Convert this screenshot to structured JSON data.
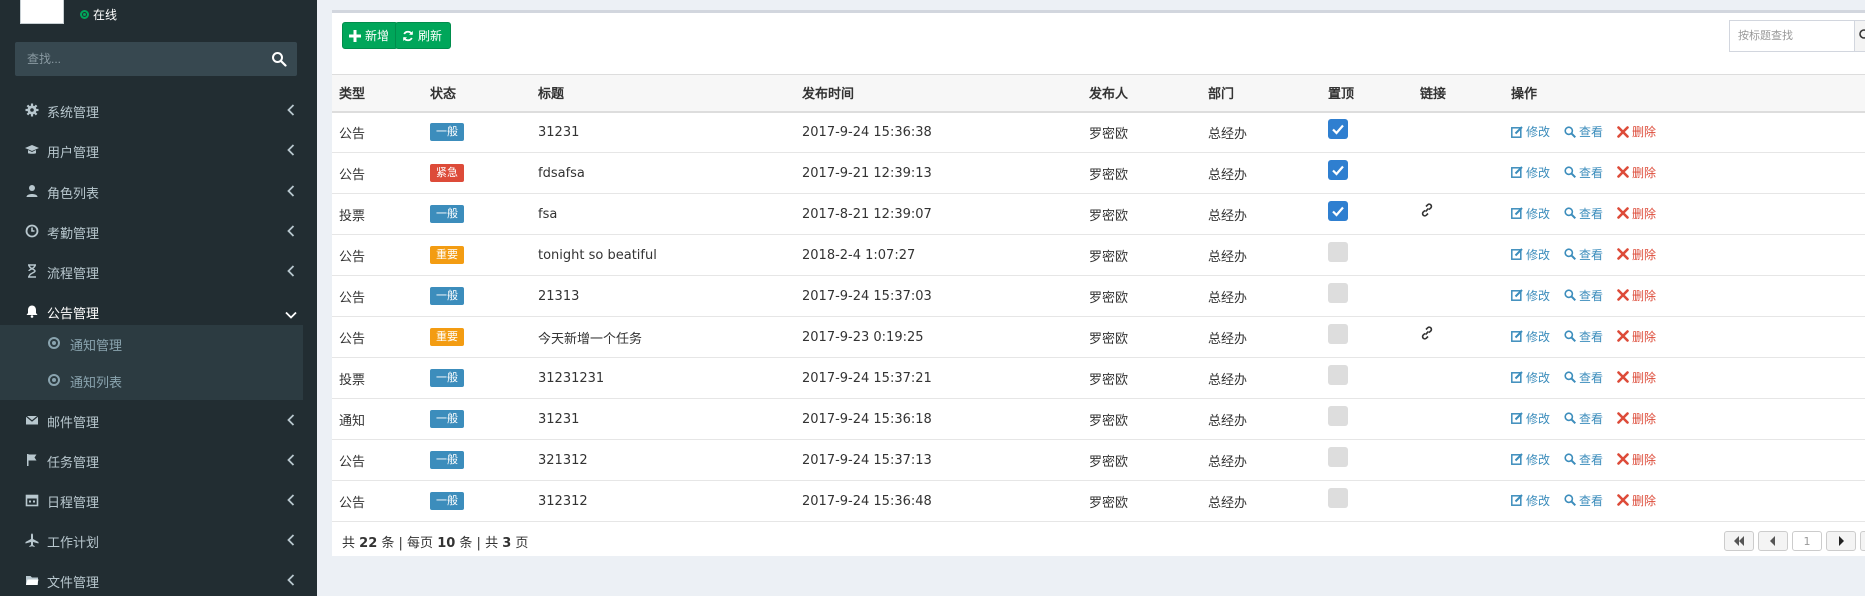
{
  "sidebar": {
    "status": "在线",
    "search_placeholder": "查找...",
    "items": [
      {
        "label": "系统管理",
        "icon": "gear-icon"
      },
      {
        "label": "用户管理",
        "icon": "graduation-cap-icon"
      },
      {
        "label": "角色列表",
        "icon": "user-icon"
      },
      {
        "label": "考勤管理",
        "icon": "clock-icon"
      },
      {
        "label": "流程管理",
        "icon": "hourglass-icon"
      },
      {
        "label": "公告管理",
        "icon": "bell-icon"
      },
      {
        "label": "邮件管理",
        "icon": "envelope-icon"
      },
      {
        "label": "任务管理",
        "icon": "flag-icon"
      },
      {
        "label": "日程管理",
        "icon": "calendar-icon"
      },
      {
        "label": "工作计划",
        "icon": "plane-icon"
      },
      {
        "label": "文件管理",
        "icon": "folder-icon"
      }
    ],
    "submenu": [
      {
        "label": "通知管理"
      },
      {
        "label": "通知列表"
      }
    ]
  },
  "toolbar": {
    "add_label": "新增",
    "refresh_label": "刷新",
    "search_placeholder": "按标题查找"
  },
  "table": {
    "headers": [
      "类型",
      "状态",
      "标题",
      "发布时间",
      "发布人",
      "部门",
      "置顶",
      "链接",
      "操作"
    ],
    "actions": {
      "edit": "修改",
      "view": "查看",
      "delete": "删除"
    },
    "rows": [
      {
        "type": "公告",
        "status": "一般",
        "title": "31231",
        "time": "2017-9-24 15:36:38",
        "publisher": "罗密欧",
        "dept": "总经办",
        "pinned": true,
        "link": false
      },
      {
        "type": "公告",
        "status": "紧急",
        "title": "fdsafsa",
        "time": "2017-9-21 12:39:13",
        "publisher": "罗密欧",
        "dept": "总经办",
        "pinned": true,
        "link": false
      },
      {
        "type": "投票",
        "status": "一般",
        "title": "fsa",
        "time": "2017-8-21 12:39:07",
        "publisher": "罗密欧",
        "dept": "总经办",
        "pinned": true,
        "link": true
      },
      {
        "type": "公告",
        "status": "重要",
        "title": "tonight so beatiful",
        "time": "2018-2-4 1:07:27",
        "publisher": "罗密欧",
        "dept": "总经办",
        "pinned": false,
        "link": false
      },
      {
        "type": "公告",
        "status": "一般",
        "title": "21313",
        "time": "2017-9-24 15:37:03",
        "publisher": "罗密欧",
        "dept": "总经办",
        "pinned": false,
        "link": false
      },
      {
        "type": "公告",
        "status": "重要",
        "title": "今天新增一个任务",
        "time": "2017-9-23 0:19:25",
        "publisher": "罗密欧",
        "dept": "总经办",
        "pinned": false,
        "link": true
      },
      {
        "type": "投票",
        "status": "一般",
        "title": "31231231",
        "time": "2017-9-24 15:37:21",
        "publisher": "罗密欧",
        "dept": "总经办",
        "pinned": false,
        "link": false
      },
      {
        "type": "通知",
        "status": "一般",
        "title": "31231",
        "time": "2017-9-24 15:36:18",
        "publisher": "罗密欧",
        "dept": "总经办",
        "pinned": false,
        "link": false
      },
      {
        "type": "公告",
        "status": "一般",
        "title": "321312",
        "time": "2017-9-24 15:37:13",
        "publisher": "罗密欧",
        "dept": "总经办",
        "pinned": false,
        "link": false
      },
      {
        "type": "公告",
        "status": "一般",
        "title": "312312",
        "time": "2017-9-24 15:36:48",
        "publisher": "罗密欧",
        "dept": "总经办",
        "pinned": false,
        "link": false
      }
    ]
  },
  "status_colors": {
    "一般": "#3c8dbc",
    "紧急": "#dd4b39",
    "重要": "#f39c12"
  },
  "footer": {
    "total_prefix": "共",
    "total": "22",
    "total_suffix": "条 | 每页",
    "per_page": "10",
    "per_page_suffix": "条 | 共",
    "pages": "3",
    "pages_suffix": "页",
    "current_page": "1"
  }
}
